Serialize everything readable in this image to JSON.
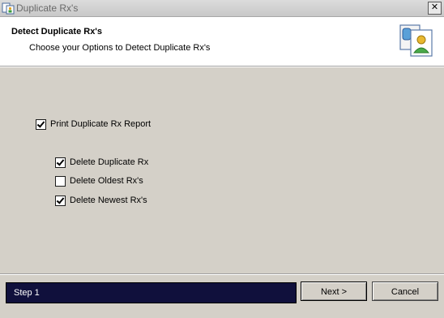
{
  "window": {
    "title": "Duplicate Rx's"
  },
  "header": {
    "title": "Detect Duplicate Rx's",
    "subtitle": "Choose your Options to Detect Duplicate Rx's"
  },
  "options": {
    "print_report": {
      "label": "Print Duplicate Rx Report",
      "checked": true
    },
    "delete_duplicate": {
      "label": "Delete Duplicate Rx",
      "checked": true
    },
    "delete_oldest": {
      "label": "Delete Oldest Rx's",
      "checked": false
    },
    "delete_newest": {
      "label": "Delete Newest Rx's",
      "checked": true
    }
  },
  "footer": {
    "step_label": "Step 1",
    "next_label": "Next >",
    "cancel_label": "Cancel",
    "step_bar_color": "#10103c"
  },
  "icons": {
    "app": "app-icon",
    "header": "users-icon",
    "close": "close-icon"
  }
}
